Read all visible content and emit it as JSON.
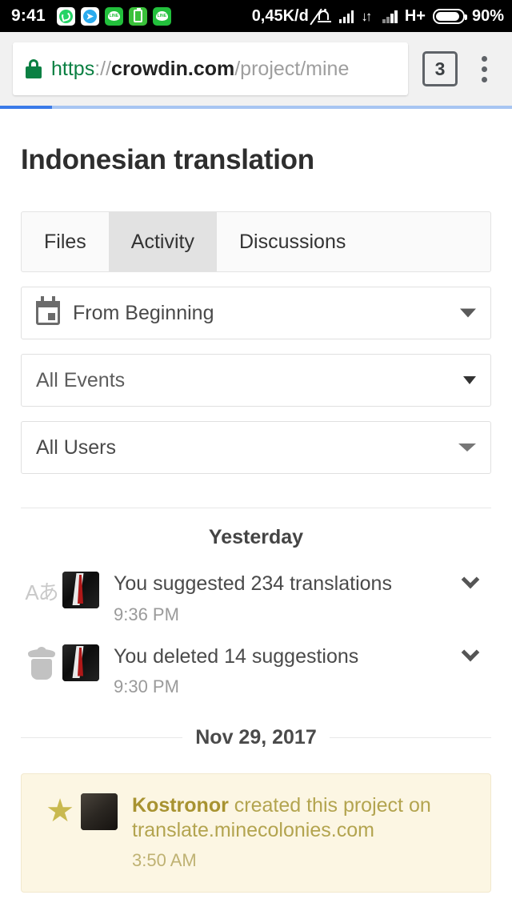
{
  "status_bar": {
    "clock": "9:41",
    "app_icons": [
      "whatsapp-icon",
      "telegram-icon",
      "line-icon",
      "battery-saver-icon",
      "line-icon"
    ],
    "data_rate": "0,45K/d",
    "mute_icon": "bell-muted-icon",
    "network_type": "H+",
    "battery_percent": "90%"
  },
  "browser": {
    "lock_icon": "lock-icon",
    "url": {
      "scheme": "https",
      "separator": "://",
      "host": "crowdin.com",
      "path": "/project/mine"
    },
    "tab_count": "3",
    "menu_icon": "kebab-menu-icon",
    "progress_percent": 10
  },
  "page": {
    "title": "Indonesian translation",
    "tabs": [
      {
        "label": "Files",
        "active": false
      },
      {
        "label": "Activity",
        "active": true
      },
      {
        "label": "Discussions",
        "active": false
      }
    ],
    "filters": [
      {
        "name": "date-range",
        "icon": "calendar-icon",
        "value": "From Beginning",
        "caret": "caret-down"
      },
      {
        "name": "event-type",
        "icon": null,
        "value": "All Events",
        "caret": "caret-down-small"
      },
      {
        "name": "user",
        "icon": null,
        "value": "All Users",
        "caret": "caret-down-wide"
      }
    ],
    "groups": [
      {
        "label": "Yesterday",
        "divider_style": "centered",
        "events": [
          {
            "type_icon": "translate-icon",
            "type_icon_glyph": "Aあ",
            "avatar": "user-avatar-suit",
            "text": "You suggested 234 translations",
            "time": "9:36 PM",
            "expand_icon": "chevron-down-icon"
          },
          {
            "type_icon": "trash-icon",
            "type_icon_glyph": "",
            "avatar": "user-avatar-suit",
            "text": "You deleted 14 suggestions",
            "time": "9:30 PM",
            "expand_icon": "chevron-down-icon"
          }
        ]
      },
      {
        "label": "Nov 29, 2017",
        "divider_style": "lines",
        "events": []
      }
    ],
    "highlight_card": {
      "star_icon": "star-icon",
      "star_glyph": "★",
      "avatar": "project-owner-avatar",
      "author": "Kostronor",
      "text_rest": " created this project on translate.minecolonies.com",
      "time": "3:50 AM"
    }
  },
  "colors": {
    "accent_blue": "#3A7AE8",
    "secure_green": "#0B8043",
    "card_background": "#FCF6E3",
    "card_text": "#B3A44F",
    "star_gold": "#C9B94F",
    "tab_active_bg": "#E2E2E2"
  }
}
